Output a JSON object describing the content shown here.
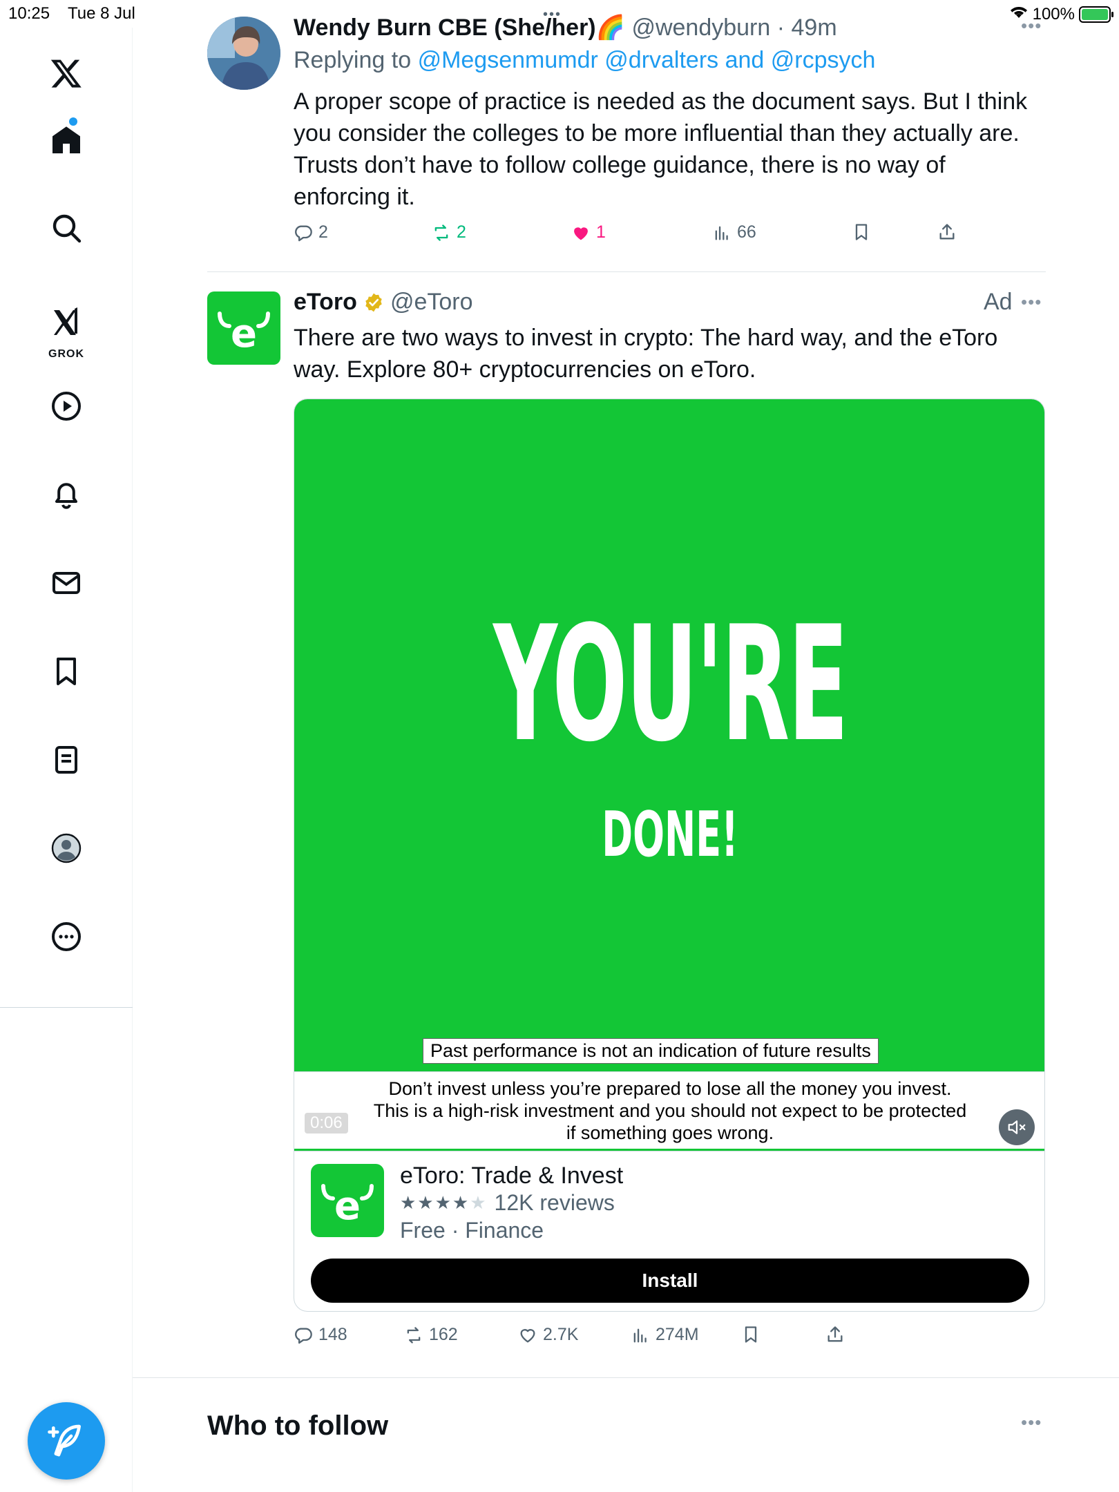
{
  "status_bar": {
    "time": "10:25",
    "date": "Tue 8 Jul",
    "battery": "100%"
  },
  "sidebar": {
    "grok_label": "GROK"
  },
  "tweet": {
    "name": "Wendy Burn CBE (She/her)",
    "name_emoji": "🌈",
    "handle": "@wendyburn",
    "time": "49m",
    "reply_prefix": "Replying to",
    "reply_handles": "@Megsenmumdr @drvalters and @rcpsych",
    "text": "A proper scope of practice is needed as the document says. But I think you consider the colleges to be more influential than they actually are. Trusts don’t have to follow college guidance, there is no way of enforcing it.",
    "replies": "2",
    "reposts": "2",
    "likes": "1",
    "views": "66"
  },
  "ad": {
    "name": "eToro",
    "handle": "@eToro",
    "ad_label": "Ad",
    "text": "There are two ways to invest in crypto: The hard way, and the eToro way. Explore 80+ cryptocurrencies on eToro.",
    "video": {
      "headline": "YOU'RE",
      "subline": "DONE!",
      "caption_past": "Past performance is not an indication of future results",
      "disclaimer_1": "Don’t invest unless you’re prepared to lose all the money you invest.",
      "disclaimer_2": "This is a high-risk investment and you should not expect to be protected",
      "disclaimer_3": "if something goes wrong.",
      "time": "0:06"
    },
    "app": {
      "name": "eToro: Trade & Invest",
      "rating_stars": 4,
      "reviews": "12K reviews",
      "meta": "Free · Finance",
      "install_label": "Install"
    },
    "replies": "148",
    "reposts": "162",
    "likes": "2.7K",
    "views": "274M"
  },
  "who_to_follow": {
    "title": "Who to follow"
  },
  "colors": {
    "accent": "#1d9bf0",
    "etoro_green": "#13c636",
    "like_pink": "#f91880",
    "repost_green": "#00ba7c"
  }
}
